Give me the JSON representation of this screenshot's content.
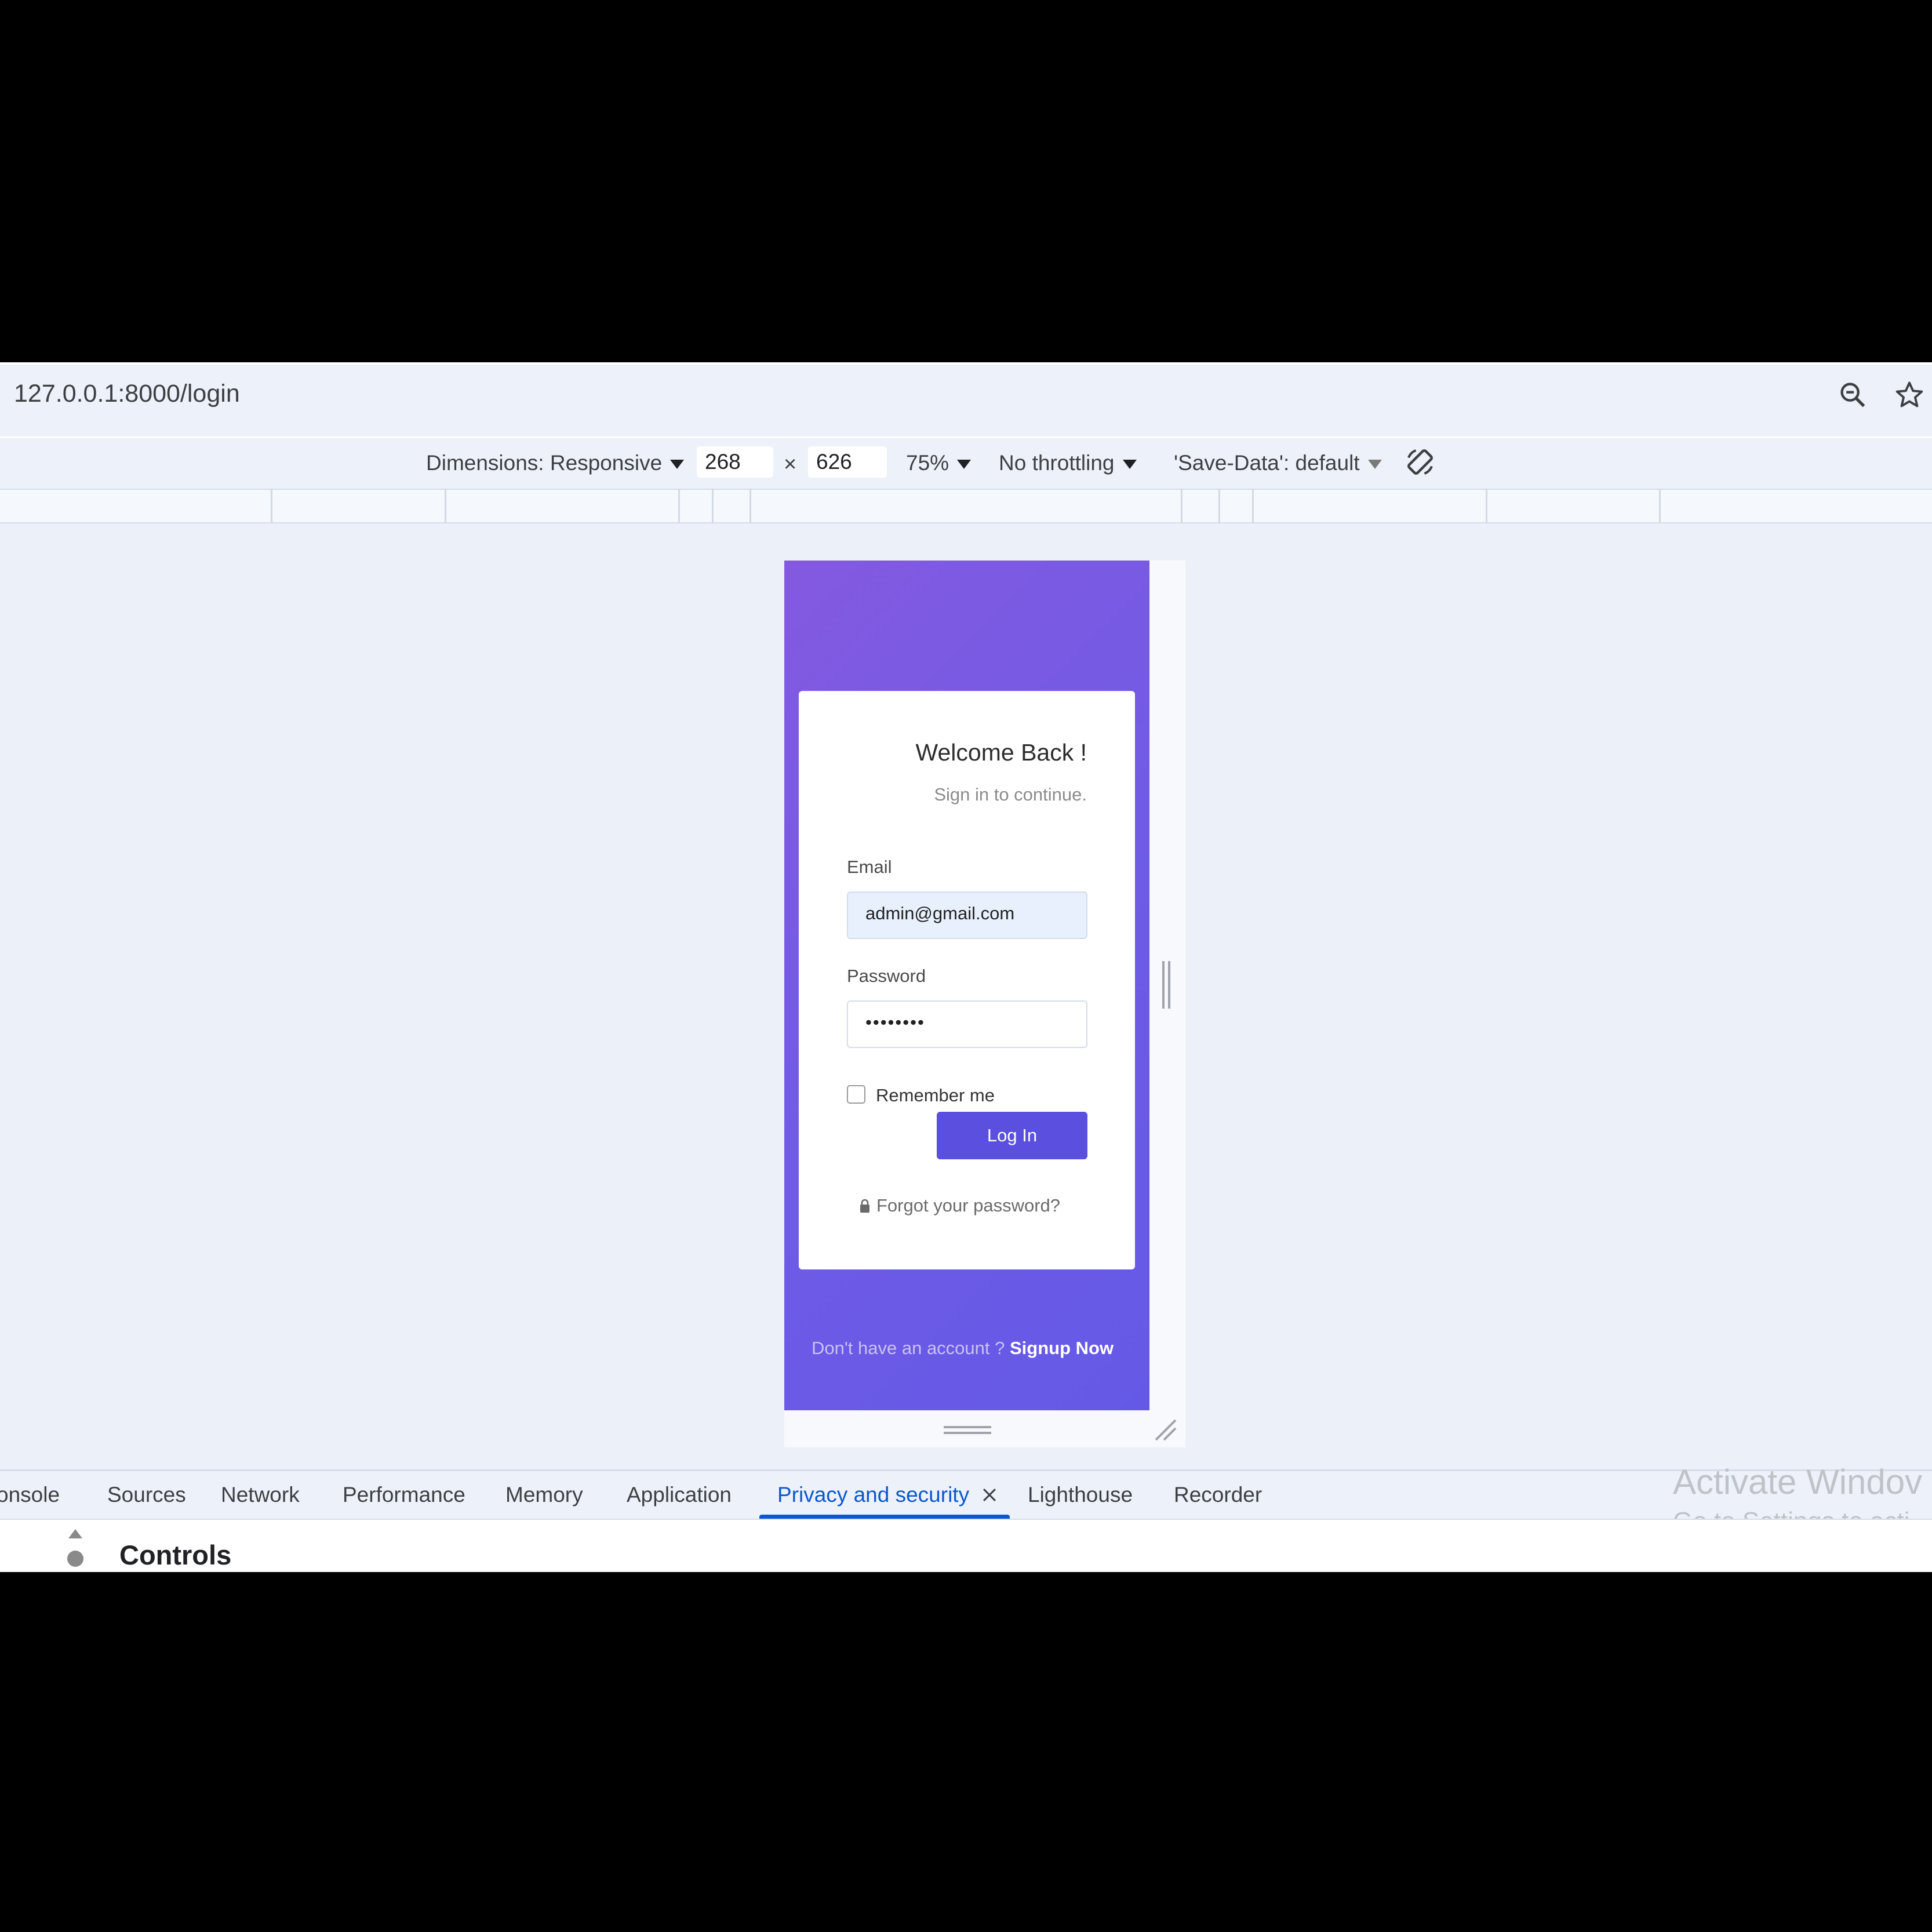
{
  "browser": {
    "url": "127.0.0.1:8000/login"
  },
  "device_toolbar": {
    "dimensions_label": "Dimensions: Responsive",
    "width": "268",
    "times": "×",
    "height": "626",
    "zoom": "75%",
    "throttling": "No throttling",
    "save_data": "'Save-Data': default"
  },
  "login": {
    "title": "Welcome Back !",
    "subtitle": "Sign in to continue.",
    "email_label": "Email",
    "email_value": "admin@gmail.com",
    "password_label": "Password",
    "password_masked": "••••••••",
    "remember_label": "Remember me",
    "login_button": "Log In",
    "forgot_link": "Forgot your password?",
    "signup_prefix": "Don't have an account ?",
    "signup_link": "Signup Now",
    "accent_color": "#5b4fe0"
  },
  "devtools": {
    "tabs": [
      "onsole",
      "Sources",
      "Network",
      "Performance",
      "Memory",
      "Application",
      "Privacy and security",
      "Lighthouse",
      "Recorder"
    ],
    "active_tab": "Privacy and security",
    "panel_title": "Controls"
  },
  "watermark": {
    "title": "Activate Windov",
    "subtitle": "Go to Settings to acti"
  },
  "icons": [
    "zoom-out-icon",
    "star-icon",
    "rotate-icon",
    "lock-icon",
    "close-icon",
    "resize-handle-icon"
  ]
}
